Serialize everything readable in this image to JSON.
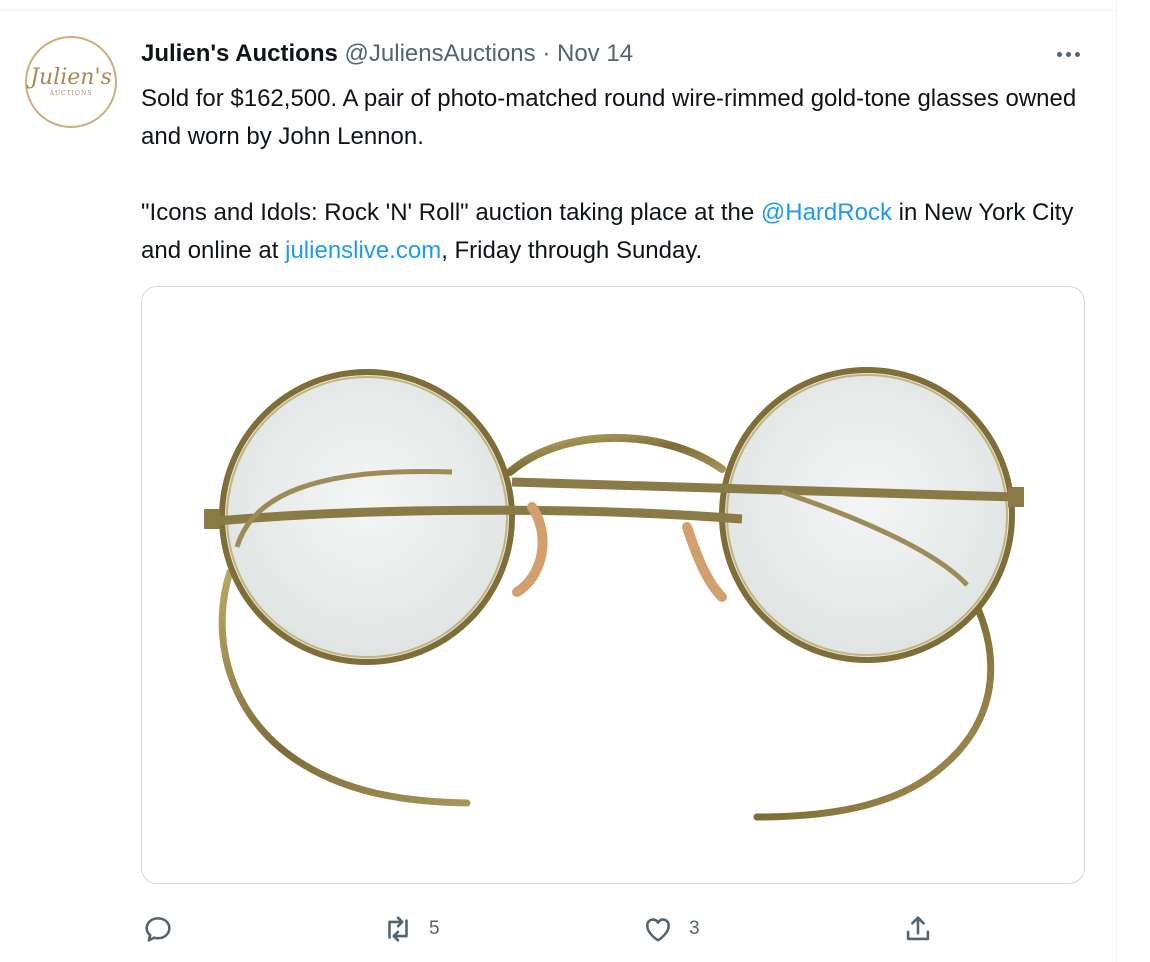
{
  "tweet": {
    "author_name": "Julien's Auctions",
    "handle": "@JuliensAuctions",
    "separator": "·",
    "date": "Nov 14",
    "avatar_text": "Julien's",
    "avatar_subtext": "AUCTIONS",
    "text_line1": "Sold for $162,500. A pair of photo-matched round wire-rimmed gold-tone glasses owned and worn by John Lennon.",
    "text_line2_pre": "\"Icons and Idols: Rock 'N' Roll\" auction taking place at the ",
    "mention": "@HardRock",
    "text_line2_mid": " in New York City and online at ",
    "url": "julienslive.com",
    "text_line2_post": ", Friday through Sunday.",
    "image_description_icon": "round-wire-rimmed-glasses-photo"
  },
  "actions": {
    "reply_icon": "reply-icon",
    "retweet_icon": "retweet-icon",
    "retweet_count": "5",
    "like_icon": "heart-icon",
    "like_count": "3",
    "share_icon": "share-icon"
  },
  "colors": {
    "link": "#1d9bf0",
    "secondary_text": "#536471",
    "border": "#cfd9de",
    "gold": "#8a7a45"
  }
}
